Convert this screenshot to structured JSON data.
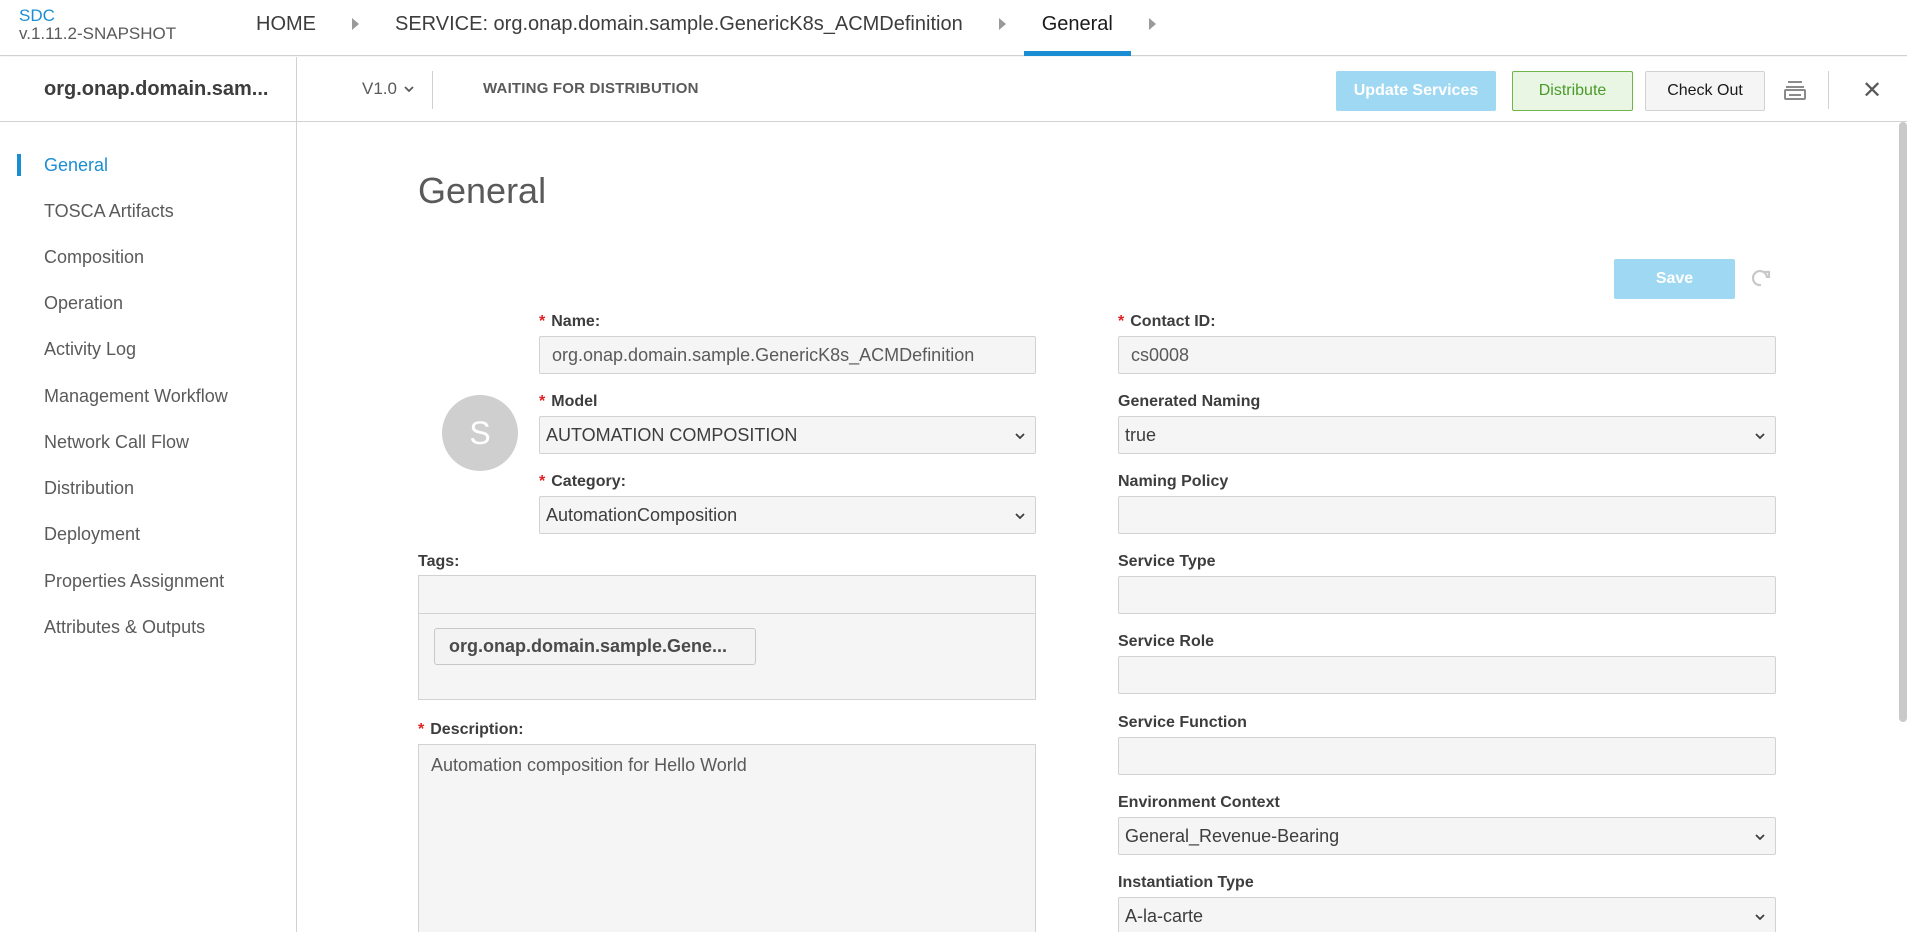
{
  "brand": {
    "name": "SDC",
    "version": "v.1.11.2-SNAPSHOT"
  },
  "breadcrumb": [
    {
      "label": "HOME"
    },
    {
      "label": "SERVICE: org.onap.domain.sample.GenericK8s_ACMDefinition"
    },
    {
      "label": "General"
    }
  ],
  "subheader": {
    "resource_name": "org.onap.domain.sam...",
    "version": "V1.0",
    "status": "WAITING FOR DISTRIBUTION",
    "update_services_label": "Update Services",
    "distribute_label": "Distribute",
    "check_out_label": "Check Out"
  },
  "sidebar": {
    "items": [
      {
        "label": "General",
        "active": true
      },
      {
        "label": "TOSCA Artifacts"
      },
      {
        "label": "Composition"
      },
      {
        "label": "Operation"
      },
      {
        "label": "Activity Log"
      },
      {
        "label": "Management Workflow"
      },
      {
        "label": "Network Call Flow"
      },
      {
        "label": "Distribution"
      },
      {
        "label": "Deployment"
      },
      {
        "label": "Properties Assignment"
      },
      {
        "label": "Attributes & Outputs"
      }
    ]
  },
  "main": {
    "title": "General",
    "save_label": "Save",
    "avatar_letter": "S",
    "name_label": "Name:",
    "name_value": "org.onap.domain.sample.GenericK8s_ACMDefinition",
    "model_label": "Model",
    "model_value": "AUTOMATION COMPOSITION",
    "category_label": "Category:",
    "category_value": "AutomationComposition",
    "tags_label": "Tags:",
    "tag_chip": "org.onap.domain.sample.Gene...",
    "description_label": "Description:",
    "description_value": "Automation composition for Hello World",
    "contact_label": "Contact ID:",
    "contact_value": "cs0008",
    "generated_naming_label": "Generated Naming",
    "generated_naming_value": "true",
    "naming_policy_label": "Naming Policy",
    "naming_policy_value": "",
    "service_type_label": "Service Type",
    "service_type_value": "",
    "service_role_label": "Service Role",
    "service_role_value": "",
    "service_function_label": "Service Function",
    "service_function_value": "",
    "environment_context_label": "Environment Context",
    "environment_context_value": "General_Revenue-Bearing",
    "instantiation_type_label": "Instantiation Type",
    "instantiation_type_value": "A-la-carte"
  },
  "colors": {
    "accent": "#1b8ed3",
    "required": "#e02020",
    "distribute_border": "#70b44a",
    "disabled_button": "#9fd8f2"
  }
}
